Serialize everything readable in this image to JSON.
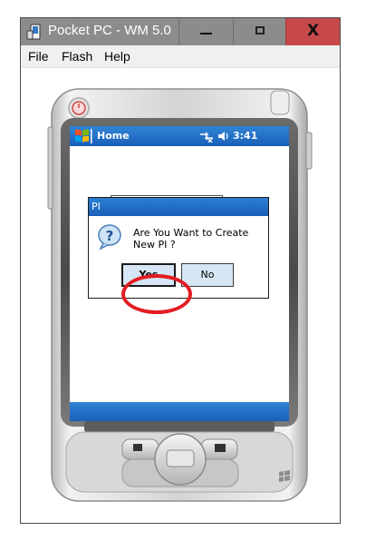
{
  "window": {
    "title": "Pocket PC - WM 5.0",
    "close_glyph": "X"
  },
  "menu": {
    "items": [
      "File",
      "Flash",
      "Help"
    ]
  },
  "device": {
    "taskbar": {
      "title": "Home",
      "time": "3:41",
      "icons": [
        "windows-start-icon",
        "connectivity-icon",
        "speaker-icon"
      ]
    },
    "dialog": {
      "title": "PI",
      "message": "Are You Want to Create New PI ?",
      "yes_label": "Yes",
      "no_label": "No",
      "icon": "question-icon"
    }
  },
  "colors": {
    "titlebar": "#8c8c8c",
    "close_button": "#c7494a",
    "wm_blue": "#1a5fb8",
    "dialog_button": "#d6e6f5",
    "highlight_circle": "#e31c23"
  }
}
